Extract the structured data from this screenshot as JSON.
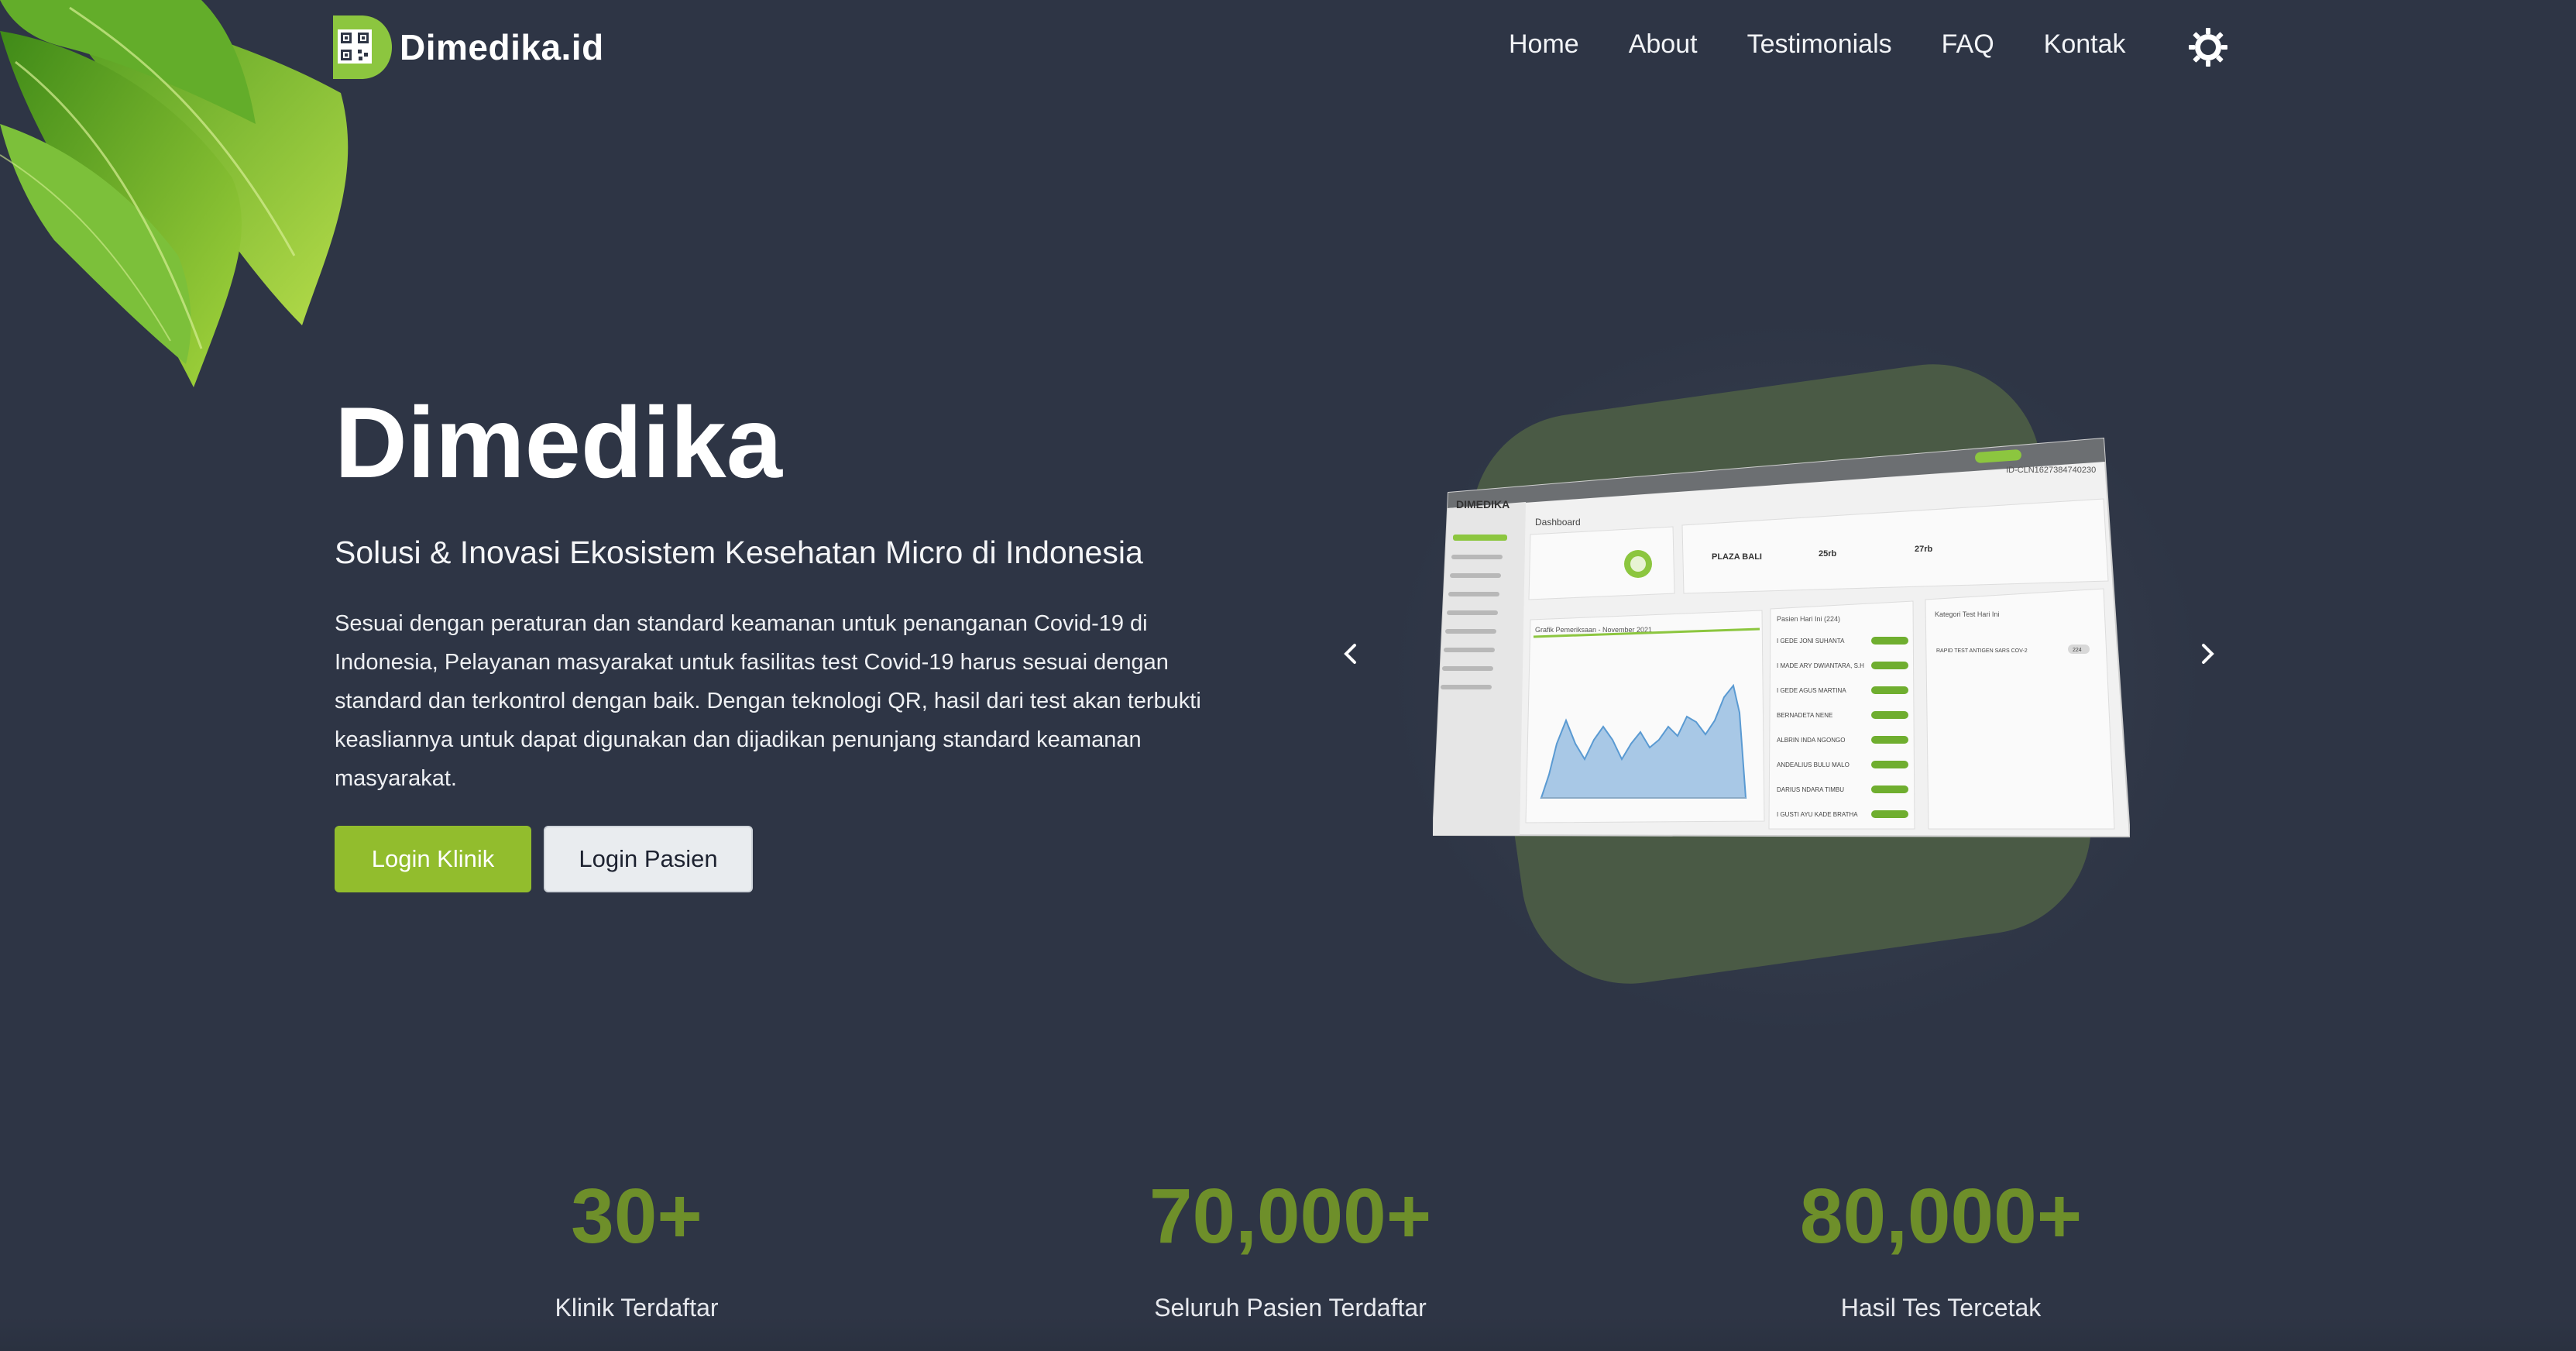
{
  "brand": {
    "name": "Dimedika.id",
    "logo_icon": "qr-code-icon"
  },
  "nav": {
    "items": [
      "Home",
      "About",
      "Testimonials",
      "FAQ",
      "Kontak"
    ],
    "theme_toggle_icon": "sun-icon"
  },
  "hero": {
    "title": "Dimedika",
    "subtitle": "Solusi & Inovasi Ekosistem Kesehatan Micro di Indonesia",
    "description": "Sesuai dengan peraturan dan standard keamanan untuk penanganan Covid-19 di Indonesia, Pelayanan masyarakat untuk fasilitas test Covid-19 harus sesuai dengan standard dan terkontrol dengan baik. Dengan teknologi QR, hasil dari test akan terbukti keasliannya untuk dapat digunakan dan dijadikan penunjang standard keamanan masyarakat.",
    "login_klinik": "Login Klinik",
    "login_pasien": "Login Pasien"
  },
  "carousel": {
    "prev_icon": "chevron-left-icon",
    "next_icon": "chevron-right-icon",
    "slide": {
      "brand": "DIMEDIKA",
      "page_title": "Dashboard",
      "id_label": "ID-CLN1627384740230",
      "stat_location": "PLAZA BALI",
      "stat_1": "25rb",
      "stat_2": "27rb",
      "chart_title": "Grafik Pemeriksaan - November 2021",
      "patients_title": "Pasien Hari Ini (224)",
      "patients": [
        "I GEDE JONI SUHANTA",
        "I MADE ARY DWIANTARA, S.H",
        "I GEDE AGUS MARTINA",
        "BERNADETA NENE",
        "ALBRIN INDA NGONGO",
        "ANDEALIUS BULU MALO",
        "DARIUS NDARA TIMBU",
        "I GUSTI AYU KADE BRATHA"
      ],
      "category_title": "Kategori Test Hari Ini",
      "category_item": "RAPID TEST ANTIGEN SARS COV-2",
      "category_count": "224"
    }
  },
  "stats": [
    {
      "value": "30+",
      "label": "Klinik Terdaftar"
    },
    {
      "value": "70,000+",
      "label": "Seluruh Pasien Terdaftar"
    },
    {
      "value": "80,000+",
      "label": "Hasil Tes Tercetak"
    }
  ],
  "colors": {
    "background": "#2e3545",
    "accent_green": "#92bd2d",
    "stat_green": "#6e8f2a",
    "leaf_green": "#8cc63f"
  }
}
